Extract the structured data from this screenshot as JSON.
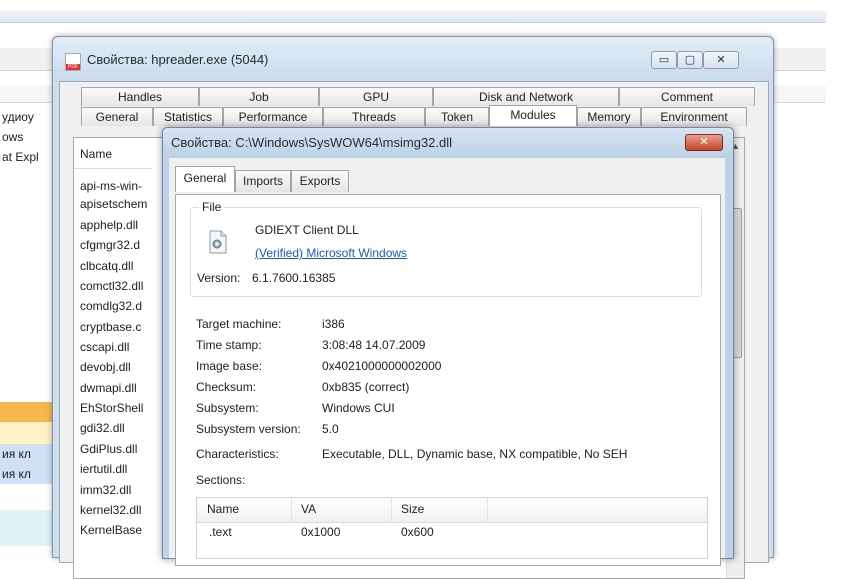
{
  "background_app": {
    "rows": [
      "удиоу",
      "ows",
      "at Expl"
    ],
    "highlight_rows": [
      "ия кл",
      "ия кл"
    ]
  },
  "process_window": {
    "title": "Свойства: hpreader.exe (5044)",
    "controls": {
      "minimize": "▭",
      "maximize": "▢",
      "close": "✕"
    },
    "tabs_row1": [
      "Handles",
      "Job",
      "GPU",
      "Disk and Network",
      "Comment"
    ],
    "tabs_row2": [
      "General",
      "Statistics",
      "Performance",
      "Threads",
      "Token",
      "Modules",
      "Memory",
      "Environment"
    ],
    "active_tab": "Modules",
    "list": {
      "column": "Name",
      "items": [
        "api-ms-win-",
        "apisetschem",
        "apphelp.dll",
        "cfgmgr32.d",
        "clbcatq.dll",
        "comctl32.dll",
        "comdlg32.d",
        "cryptbase.c",
        "cscapi.dll",
        "devobj.dll",
        "dwmapi.dll",
        "EhStorShell",
        "gdi32.dll",
        "GdiPlus.dll",
        "iertutil.dll",
        "imm32.dll",
        "kernel32.dll",
        "KernelBase"
      ]
    }
  },
  "dll_dialog": {
    "title": "Свойства: C:\\Windows\\SysWOW64\\msimg32.dll",
    "close_label": "✕",
    "tabs": [
      "General",
      "Imports",
      "Exports"
    ],
    "active_tab": "General",
    "file": {
      "group_label": "File",
      "description": "GDIEXT Client DLL",
      "verified": "(Verified) Microsoft Windows",
      "version_label": "Version:",
      "version": "6.1.7600.16385"
    },
    "properties": [
      {
        "label": "Target machine:",
        "value": "i386"
      },
      {
        "label": "Time stamp:",
        "value": "3:08:48 14.07.2009"
      },
      {
        "label": "Image base:",
        "value": "0x4021000000002000"
      },
      {
        "label": "Checksum:",
        "value": "0xb835 (correct)"
      },
      {
        "label": "Subsystem:",
        "value": "Windows CUI"
      },
      {
        "label": "Subsystem version:",
        "value": "5.0"
      },
      {
        "label": "Characteristics:",
        "value": "Executable, DLL, Dynamic base, NX compatible, No SEH"
      }
    ],
    "sections_label": "Sections:",
    "sections_table": {
      "columns": [
        "Name",
        "VA",
        "Size"
      ],
      "rows": [
        [
          ".text",
          "0x1000",
          "0x600"
        ]
      ]
    }
  }
}
